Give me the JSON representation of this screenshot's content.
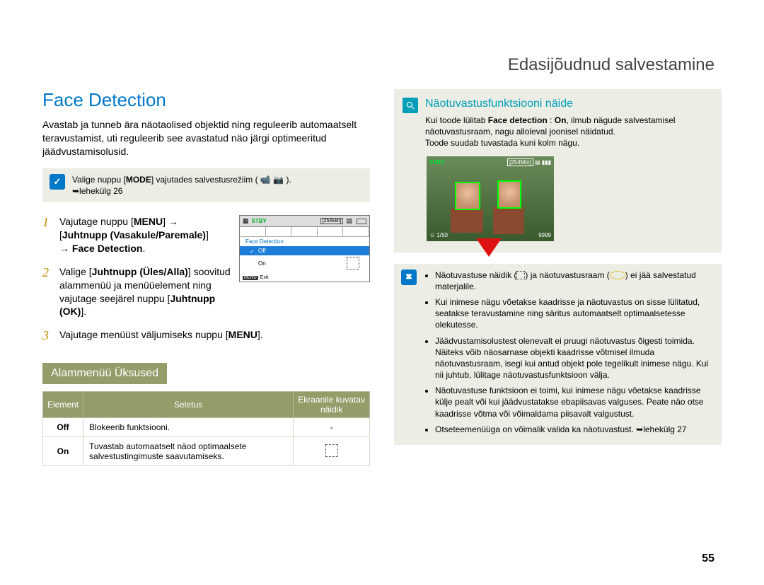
{
  "chapter": "Edasijõudnud salvestamine",
  "page_number": "55",
  "section_title": "Face Detection",
  "intro": "Avastab ja tunneb ära näotaolised objektid ning reguleerib automaatselt teravustamist, uti reguleerib see avastatud näo järgi optimeeritud jäädvustamisolusid.",
  "mode_note_prefix": "Valige nuppu [",
  "mode_note_mode": "MODE",
  "mode_note_mid": "] vajutades salvestusrežiim (",
  "mode_note_suffix": ").",
  "mode_note_page": "➥lehekülg 26",
  "steps": {
    "s1_a": "Vajutage nuppu [",
    "s1_menu": "MENU",
    "s1_b": "] →",
    "s1_c": "[",
    "s1_nav": "Juhtnupp (Vasakule/Paremale)",
    "s1_d": "]",
    "s1_e": "→ ",
    "s1_fd": "Face Detection",
    "s1_f": ".",
    "s2_a": "Valige [",
    "s2_nav": "Juhtnupp (Üles/Alla)",
    "s2_b": "] soovitud alammenüü ja menüüelement ning vajutage seejärel nuppu [",
    "s2_ok": "Juhtnupp (OK)",
    "s2_c": "].",
    "s3_a": "Vajutage menüüst väljumiseks nuppu [",
    "s3_menu": "MENU",
    "s3_b": "]."
  },
  "menu_shot": {
    "stby": "STBY",
    "time": "[254Min]",
    "title": "Face Detection",
    "off": "Off",
    "on": "On",
    "menu_key": "MENU",
    "exit": "Exit"
  },
  "submenu_title": "Alammenüü Üksused",
  "table": {
    "h1": "Element",
    "h2": "Seletus",
    "h3": "Ekraanile kuvatav näidik",
    "r1c1": "Off",
    "r1c2": "Blokeerib funktsiooni.",
    "r1c3": "-",
    "r2c1": "On",
    "r2c2": "Tuvastab automaatselt näod optimaalsete salvestustingimuste saavutamiseks."
  },
  "example": {
    "heading": "Näotuvastusfunktsiooni näide",
    "p1a": "Kui toode lülitab ",
    "p1b": "Face detection",
    "p1c": " : ",
    "p1d": "On",
    "p1e": ", ilmub nägude salvestamisel näotuvastusraam, nagu alloleval joonisel näidatud.",
    "p2": "Toode suudab tuvastada kuni kolm nägu."
  },
  "photo_hud": {
    "stby": "STBY",
    "time": "[254Min]",
    "shots": "9999",
    "rec": "1/50"
  },
  "tips": {
    "b1a": "Näotuvastuse näidik (",
    "b1b": ") ja näotuvastusraam (",
    "b1c": ") ei jää salvestatud materjalile.",
    "b2": "Kui inimese nägu võetakse kaadrisse ja näotuvastus on sisse lülitatud, seatakse teravustamine ning säritus automaatselt optimaalsetesse olekutesse.",
    "b3": "Jäädvustamisolustest olenevalt ei pruugi näotuvastus õigesti toimida. Näiteks võib näosarnase objekti kaadrisse võtmisel ilmuda näotuvastusraam, isegi kui antud objekt pole tegelikult inimese nägu. Kui nii juhtub, lülitage näotuvastusfunktsioon välja.",
    "b4": "Näotuvastuse funktsioon ei toimi, kui inimese nägu võetakse kaadrisse külje pealt või kui jäädvustatakse ebapiisavas valguses. Peate näo otse kaadrisse võtma või võimaldama piisavalt valgustust.",
    "b5": "Otseteemenüüga on võimalik valida ka näotuvastust. ➥lehekülg 27"
  }
}
